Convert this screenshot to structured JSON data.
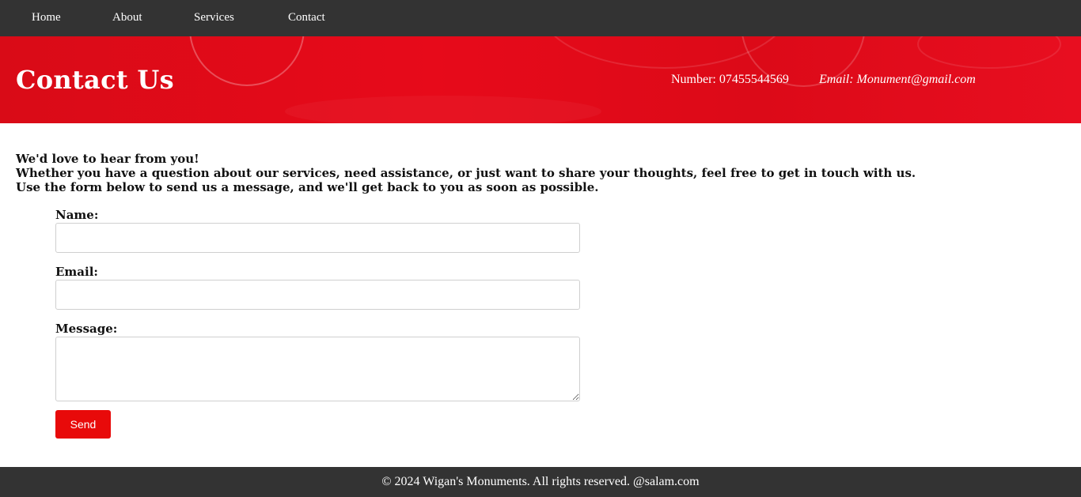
{
  "nav": {
    "items": [
      "Home",
      "About",
      "Services",
      "Contact"
    ]
  },
  "hero": {
    "title": "Contact Us",
    "phone": "Number: 07455544569",
    "email": "Email: Monument@gmail.com"
  },
  "intro": {
    "line1": "We'd love to hear from you!",
    "line2": "Whether you have a question about our services, need assistance, or just want to share your thoughts, feel free to get in touch with us.",
    "line3": "Use the form below to send us a message, and we'll get back to you as soon as possible."
  },
  "form": {
    "name_label": "Name:",
    "name_value": "",
    "email_label": "Email:",
    "email_value": "",
    "message_label": "Message:",
    "message_value": "",
    "send_label": "Send"
  },
  "footer": {
    "text": "© 2024 Wigan's Monuments. All rights reserved. @salam.com"
  },
  "colors": {
    "nav_bg": "#333333",
    "hero_red": "#e00a1a",
    "button_red": "#e80a0a",
    "footer_bg": "#333333"
  }
}
